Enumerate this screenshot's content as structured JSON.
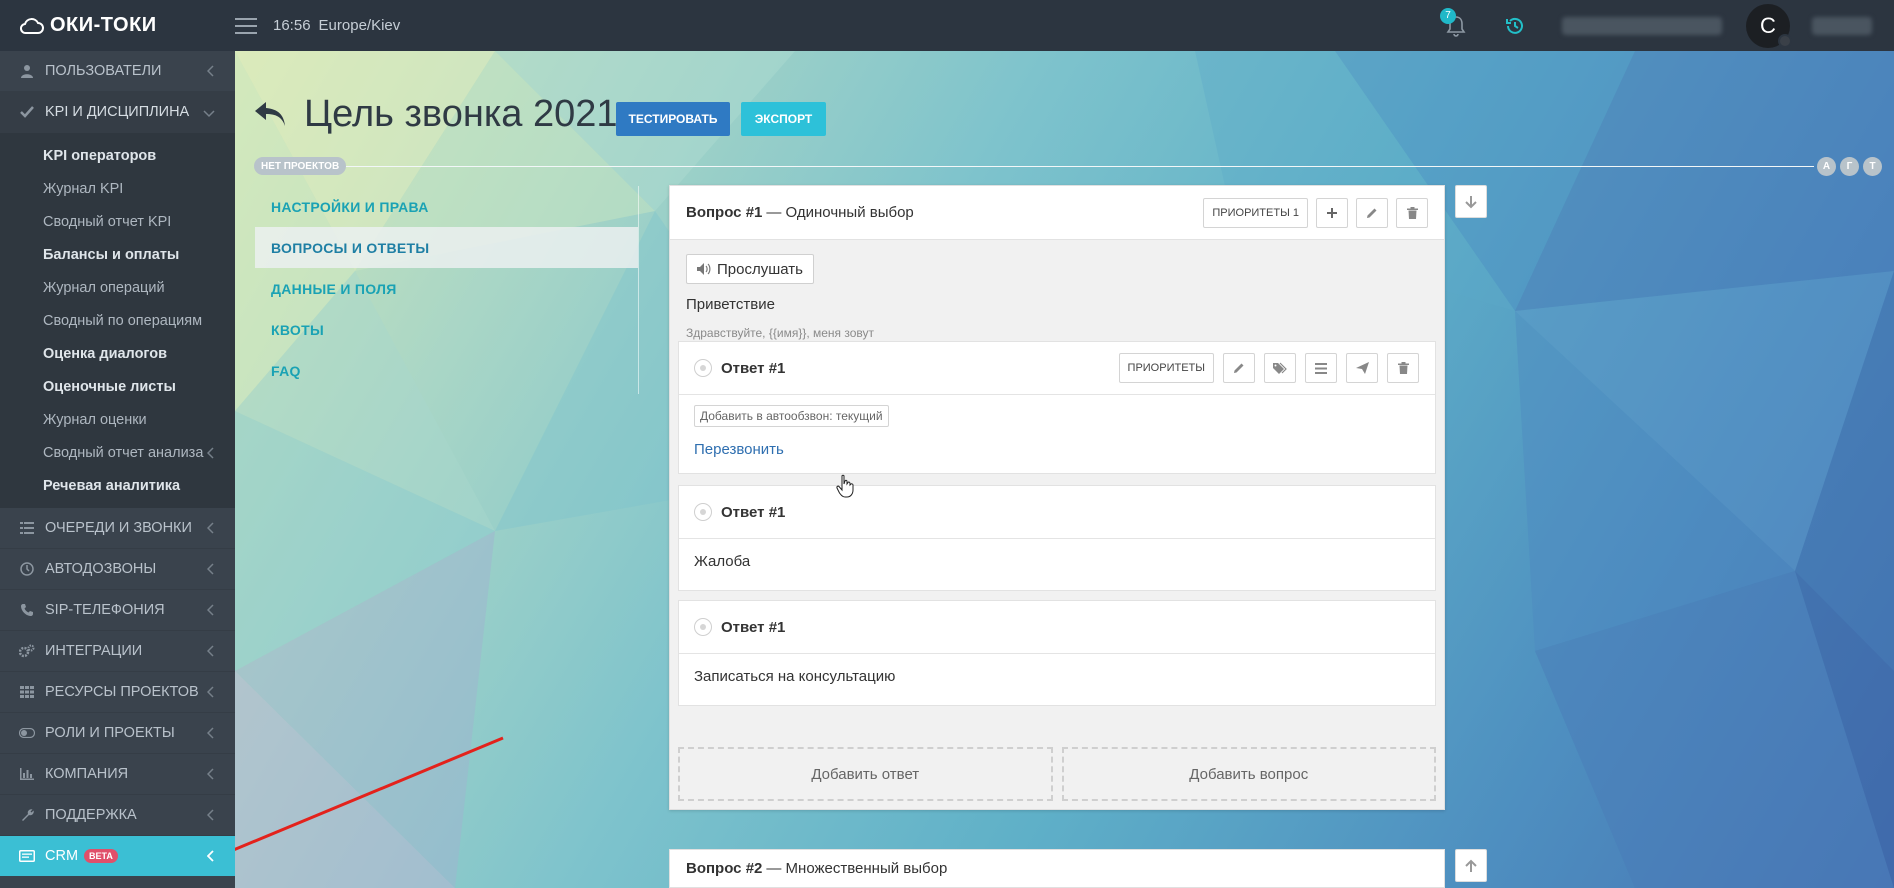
{
  "app": {
    "logo": "ОКИ-ТОКИ",
    "time": "16:56",
    "timezone": "Europe/Kiev",
    "notifications_count": "7",
    "avatar_letter": "C"
  },
  "sidebar": {
    "items": [
      {
        "label": "ПОЛЬЗОВАТЕЛИ"
      },
      {
        "label": "KPI И ДИСЦИПЛИНА"
      }
    ],
    "kpi_sub": [
      {
        "label": "KPI операторов"
      },
      {
        "label": "Журнал KPI"
      },
      {
        "label": "Сводный отчет KPI"
      },
      {
        "label": "Балансы и оплаты"
      },
      {
        "label": "Журнал операций"
      },
      {
        "label": "Сводный по операциям"
      },
      {
        "label": "Оценка диалогов"
      },
      {
        "label": "Оценочные листы"
      },
      {
        "label": "Журнал оценки"
      },
      {
        "label": "Сводный отчет анализа"
      },
      {
        "label": "Речевая аналитика"
      }
    ],
    "rest": [
      {
        "label": "ОЧЕРЕДИ И ЗВОНКИ"
      },
      {
        "label": "АВТОДОЗВОНЫ"
      },
      {
        "label": "SIP-ТЕЛЕФОНИЯ"
      },
      {
        "label": "ИНТЕГРАЦИИ"
      },
      {
        "label": "РЕСУРСЫ ПРОЕКТОВ"
      },
      {
        "label": "РОЛИ И ПРОЕКТЫ"
      },
      {
        "label": "КОМПАНИЯ"
      },
      {
        "label": "ПОДДЕРЖКА"
      }
    ],
    "crm": {
      "label": "CRM",
      "badge": "BETA"
    }
  },
  "header": {
    "title": "Цель звонка 2021",
    "test_button": "ТЕСТИРОВАТЬ",
    "export_button": "ЭКСПОРТ",
    "projects_pill": "НЕТ ПРОЕКТОВ",
    "letters": [
      "А",
      "Г",
      "Т"
    ]
  },
  "tabs": [
    {
      "label": "НАСТРОЙКИ И ПРАВА"
    },
    {
      "label": "ВОПРОСЫ И ОТВЕТЫ"
    },
    {
      "label": "ДАННЫЕ И ПОЛЯ"
    },
    {
      "label": "КВОТЫ"
    },
    {
      "label": "FAQ"
    }
  ],
  "question1": {
    "number": "Вопрос #1",
    "type": "— Одиночный выбор",
    "priorities_button": "ПРИОРИТЕТЫ 1",
    "listen_button": "Прослушать",
    "title": "Приветствие",
    "text": "Здравствуйте, {{имя}}, меня зовут",
    "answers": [
      {
        "label": "Ответ #1",
        "priorities_button": "ПРИОРИТЕТЫ",
        "tag": "Добавить в автообзвон: текущий",
        "link": "Перезвонить"
      },
      {
        "label": "Ответ #1",
        "body": "Жалоба"
      },
      {
        "label": "Ответ #1",
        "body": "Записаться на консультацию"
      }
    ],
    "add_answer": "Добавить ответ",
    "add_question": "Добавить вопрос"
  },
  "question2": {
    "number": "Вопрос #2",
    "type": "— Множественный выбор"
  }
}
